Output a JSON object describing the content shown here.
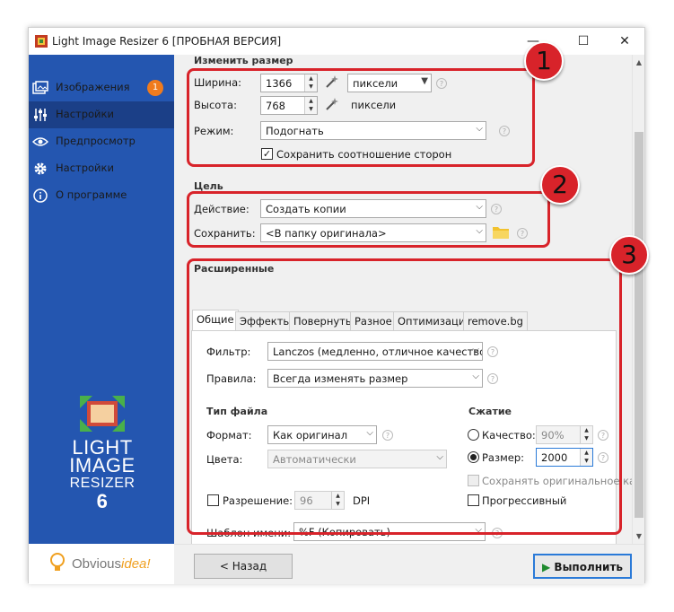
{
  "window": {
    "title": "Light Image Resizer 6  [ПРОБНАЯ ВЕРСИЯ]",
    "controls": [
      "—",
      "☐",
      "✕"
    ]
  },
  "sidebar": {
    "items": [
      {
        "label": "Изображения",
        "icon": "images-icon",
        "badge": "1"
      },
      {
        "label": "Настройки",
        "icon": "sliders-icon"
      },
      {
        "label": "Предпросмотр",
        "icon": "eye-icon"
      },
      {
        "label": "Настройки",
        "icon": "gear-icon"
      },
      {
        "label": "О программе",
        "icon": "info-icon"
      }
    ],
    "logo_lines": [
      "LIGHT",
      "IMAGE",
      "RESIZER",
      "6"
    ],
    "brand": {
      "part1": "Obvious",
      "part2": "idea!"
    }
  },
  "resize": {
    "section_title": "Изменить размер",
    "width_label": "Ширина:",
    "width_value": "1366",
    "width_unit": "пиксели",
    "height_label": "Высота:",
    "height_value": "768",
    "height_unit": "пиксели",
    "mode_label": "Режим:",
    "mode_value": "Подогнать",
    "keep_ratio_label": "Сохранить соотношение сторон",
    "keep_ratio_checked": true
  },
  "target": {
    "section_title": "Цель",
    "action_label": "Действие:",
    "action_value": "Создать копии",
    "save_label": "Сохранить:",
    "save_value": "<В папку оригинала>"
  },
  "advanced": {
    "section_title": "Расширенные",
    "tabs": [
      "Общие",
      "Эффекты",
      "Повернуть",
      "Разное",
      "Оптимизация",
      "remove.bg"
    ],
    "active_tab": "Общие",
    "filter_label": "Фильтр:",
    "filter_value": "Lanczos  (медленно, отличное качество)",
    "rules_label": "Правила:",
    "rules_value": "Всегда изменять размер",
    "filetype_title": "Тип файла",
    "format_label": "Формат:",
    "format_value": "Как оригинал",
    "colors_label": "Цвета:",
    "colors_value": "Автоматически",
    "compression_title": "Сжатие",
    "quality_label": "Качество:",
    "quality_value": "90%",
    "size_label": "Размер:",
    "size_value": "2000",
    "keep_original_label": "Сохранять оригинальное ка",
    "progressive_label": "Прогрессивный",
    "resolution_label": "Разрешение:",
    "resolution_value": "96",
    "resolution_unit": "DPI",
    "template_label": "Шаблон имени:",
    "template_value": "%F (Копировать)"
  },
  "markers": [
    "1",
    "2",
    "3"
  ],
  "buttons": {
    "back": "< Назад",
    "run": "Выполнить"
  },
  "colors": {
    "sidebar": "#2456b0",
    "sidebar_active": "#1b3f87",
    "annotation": "#d8232a",
    "badge": "#ef7b1d"
  }
}
